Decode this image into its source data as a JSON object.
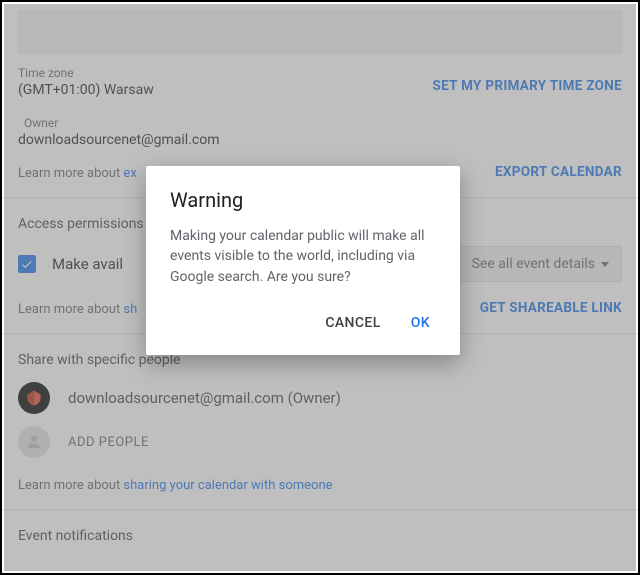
{
  "timezone": {
    "label": "Time zone",
    "value": "(GMT+01:00) Warsaw"
  },
  "owner": {
    "label": "Owner",
    "value": "downloadsourcenet@gmail.com"
  },
  "actions": {
    "set_primary_tz": "SET MY PRIMARY TIME ZONE",
    "export_calendar": "EXPORT CALENDAR",
    "get_shareable_link": "GET SHAREABLE LINK"
  },
  "learn": {
    "prefix": "Learn more about ",
    "exporting_partial": "ex",
    "sharing_partial": "sh",
    "sharing_full": "sharing your calendar with someone"
  },
  "access": {
    "title": "Access permissions",
    "make_available": "Make avail",
    "select_value": "See all event details"
  },
  "share": {
    "title": "Share with specific people",
    "owner_row": "downloadsourcenet@gmail.com (Owner)",
    "add_people": "ADD PEOPLE"
  },
  "notifications": {
    "title": "Event notifications"
  },
  "dialog": {
    "title": "Warning",
    "body": "Making your calendar public will make all events visible to the world, including via Google search. Are you sure?",
    "cancel": "CANCEL",
    "ok": "OK"
  }
}
